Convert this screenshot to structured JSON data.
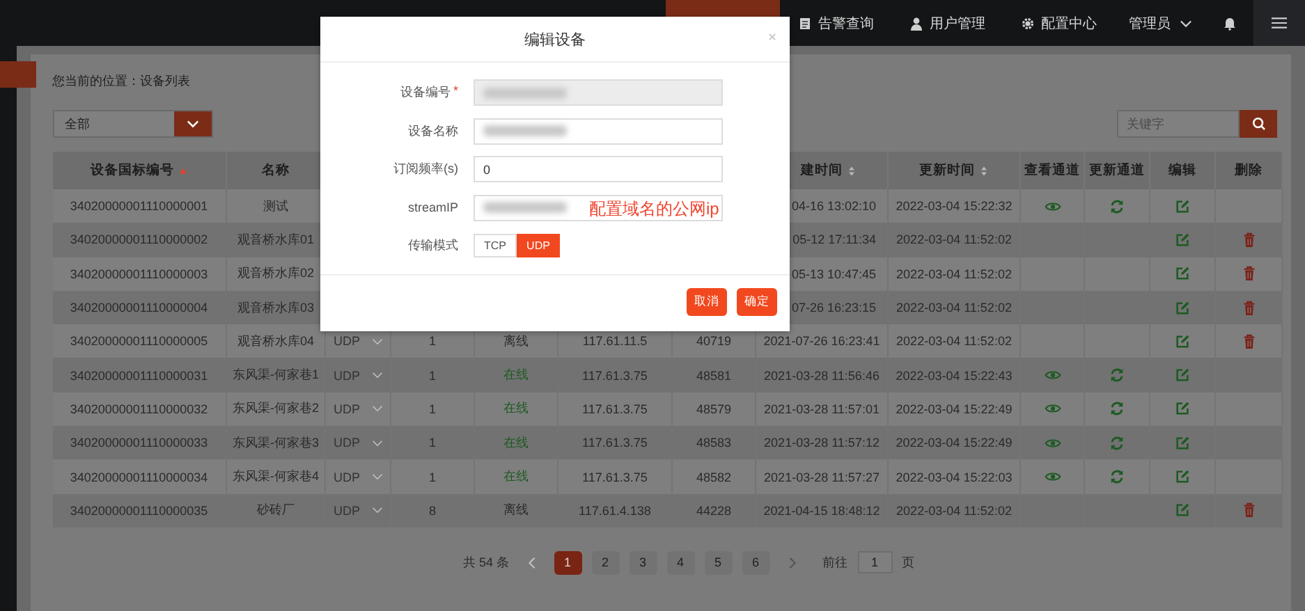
{
  "nav": {
    "items": [
      {
        "label": "告警查询"
      },
      {
        "label": "用户管理"
      },
      {
        "label": "配置中心"
      }
    ],
    "user": "管理员"
  },
  "breadcrumb": "您当前的位置：设备列表",
  "filter": {
    "value": "全部"
  },
  "search": {
    "placeholder": "关键字"
  },
  "table": {
    "columns": [
      {
        "label": "设备国标编号"
      },
      {
        "label": "名称"
      },
      {},
      {},
      {},
      {},
      {},
      {
        "label": "建时间"
      },
      {
        "label": "更新时间"
      },
      {
        "label": "查看通道"
      },
      {
        "label": "更新通道"
      },
      {
        "label": "编辑"
      },
      {
        "label": "删除"
      }
    ],
    "rows": [
      {
        "id": "34020000001110000001",
        "name": "测试",
        "created": "04-16 13:02:10",
        "updated": "2022-03-04 15:22:32",
        "view": true,
        "refresh": true,
        "edit": true,
        "delete": false
      },
      {
        "id": "34020000001110000002",
        "name": "观音桥水库01",
        "created": "05-12 17:11:34",
        "updated": "2022-03-04 11:52:02",
        "view": false,
        "refresh": false,
        "edit": true,
        "delete": true
      },
      {
        "id": "34020000001110000003",
        "name": "观音桥水库02",
        "created": "05-13 10:47:45",
        "updated": "2022-03-04 11:52:02",
        "view": false,
        "refresh": false,
        "edit": true,
        "delete": true
      },
      {
        "id": "34020000001110000004",
        "name": "观音桥水库03",
        "created": "07-26 16:23:15",
        "updated": "2022-03-04 11:52:02",
        "view": false,
        "refresh": false,
        "edit": true,
        "delete": true
      },
      {
        "id": "34020000001110000005",
        "name": "观音桥水库04",
        "transport": "UDP",
        "count": "1",
        "status": "离线",
        "online": false,
        "ip": "117.61.11.5",
        "port": "40719",
        "created": "2021-07-26 16:23:41",
        "updated": "2022-03-04 11:52:02",
        "view": false,
        "refresh": false,
        "edit": true,
        "delete": true
      },
      {
        "id": "34020000001110000031",
        "name": "东风渠-何家巷1",
        "transport": "UDP",
        "count": "1",
        "status": "在线",
        "online": true,
        "ip": "117.61.3.75",
        "port": "48581",
        "created": "2021-03-28 11:56:46",
        "updated": "2022-03-04 15:22:43",
        "view": true,
        "refresh": true,
        "edit": true,
        "delete": false
      },
      {
        "id": "34020000001110000032",
        "name": "东风渠-何家巷2",
        "transport": "UDP",
        "count": "1",
        "status": "在线",
        "online": true,
        "ip": "117.61.3.75",
        "port": "48579",
        "created": "2021-03-28 11:57:01",
        "updated": "2022-03-04 15:22:49",
        "view": true,
        "refresh": true,
        "edit": true,
        "delete": false
      },
      {
        "id": "34020000001110000033",
        "name": "东风渠-何家巷3",
        "transport": "UDP",
        "count": "1",
        "status": "在线",
        "online": true,
        "ip": "117.61.3.75",
        "port": "48583",
        "created": "2021-03-28 11:57:12",
        "updated": "2022-03-04 15:22:49",
        "view": true,
        "refresh": true,
        "edit": true,
        "delete": false
      },
      {
        "id": "34020000001110000034",
        "name": "东风渠-何家巷4",
        "transport": "UDP",
        "count": "1",
        "status": "在线",
        "online": true,
        "ip": "117.61.3.75",
        "port": "48582",
        "created": "2021-03-28 11:57:27",
        "updated": "2022-03-04 15:22:03",
        "view": true,
        "refresh": true,
        "edit": true,
        "delete": false
      },
      {
        "id": "34020000001110000035",
        "name": "砂砖厂",
        "transport": "UDP",
        "count": "8",
        "status": "离线",
        "online": false,
        "ip": "117.61.4.138",
        "port": "44228",
        "created": "2021-04-15 18:48:12",
        "updated": "2022-03-04 11:52:02",
        "view": false,
        "refresh": false,
        "edit": true,
        "delete": true
      }
    ]
  },
  "pagination": {
    "total": "共 54 条",
    "pages": [
      {
        "label": "1",
        "selected": true
      },
      {
        "label": "2",
        "selected": false
      },
      {
        "label": "3",
        "selected": false
      },
      {
        "label": "4",
        "selected": false
      },
      {
        "label": "5",
        "selected": false
      },
      {
        "label": "6",
        "selected": false
      }
    ],
    "goto_label": "前往",
    "goto_value": "1",
    "goto_unit": "页"
  },
  "dialog": {
    "title": "编辑设备",
    "fields": [
      {
        "label": "设备编号",
        "required_mark": "*",
        "kind": "redacted",
        "disabled": true
      },
      {
        "label": "设备名称",
        "kind": "redacted",
        "disabled": false
      },
      {
        "label": "订阅频率(s)",
        "kind": "text",
        "value": "0",
        "disabled": false
      },
      {
        "label": "streamIP",
        "kind": "redacted",
        "disabled": false,
        "annotation": "配置域名的公网ip"
      }
    ],
    "transport": {
      "label": "传输模式",
      "options": [
        {
          "label": "TCP",
          "selected": false
        },
        {
          "label": "UDP",
          "selected": true
        }
      ]
    },
    "buttons": [
      "取消",
      "确定"
    ]
  }
}
